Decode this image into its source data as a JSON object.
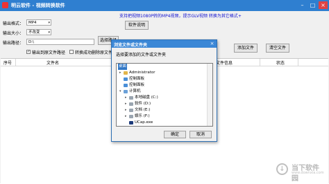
{
  "window": {
    "title": "明云软件 - 视频转换软件"
  },
  "notice": "支持把视频1080P转的MP4视频，提示GLV视频  转换为其它格式+",
  "form": {
    "format_label": "输出格式：",
    "format_value": "MP4",
    "size_label": "输出大小：",
    "size_value": "不改变",
    "path_label": "输出路径：",
    "path_value": "D:\\",
    "browse_label": "选择路径",
    "help_label": "软件说明",
    "add_label": "添加文件",
    "clear_label": "清空文件",
    "open_after_label": "输出到原文件路径",
    "delete_after_label": "转换成功删除原文件"
  },
  "table": {
    "col_index": "序号",
    "col_name": "文件名",
    "col_info": "文件信息",
    "col_status": "状态"
  },
  "dialog": {
    "title": "浏览文件或文件夹",
    "prompt": "选择要添加的文件或文件夹",
    "tree": [
      {
        "label": "桌面"
      },
      {
        "label": "Administrator"
      },
      {
        "label": "控制面板"
      },
      {
        "label": "控制面板"
      },
      {
        "label": "计算机"
      },
      {
        "label": "本地磁盘 (C:)"
      },
      {
        "label": "软件 (D:)"
      },
      {
        "label": "文档 (E:)"
      },
      {
        "label": "娱乐 (F:)"
      },
      {
        "label": "UCap.exe"
      }
    ],
    "ok_label": "确定",
    "cancel_label": "取消"
  },
  "watermark": {
    "brand": "当下软件园",
    "url": "www.downxia.com"
  }
}
